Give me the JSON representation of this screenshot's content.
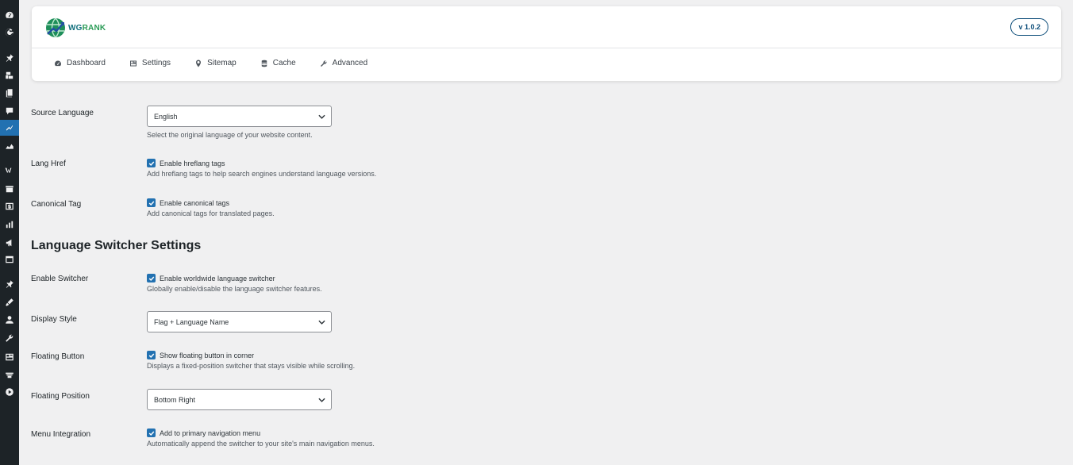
{
  "admin_menu": {
    "icons": [
      "dashboard-icon",
      "google-icon",
      "pin-icon",
      "media-icon",
      "pages-icon",
      "comments-icon",
      "wgrank-icon",
      "chart-icon",
      "woo-icon",
      "products-icon",
      "payments-icon",
      "analytics-icon",
      "marketing-icon",
      "calendar-icon",
      "tools-pin-icon",
      "appearance-icon",
      "users-icon",
      "wrench-icon",
      "settings-icon",
      "table-icon",
      "play-icon"
    ]
  },
  "header": {
    "logo_text_a": "WG",
    "logo_text_b": "RANK",
    "version": "v 1.0.2",
    "tabs": [
      {
        "label": "Dashboard",
        "icon": "dashboard-icon"
      },
      {
        "label": "Settings",
        "icon": "settings-icon"
      },
      {
        "label": "Sitemap",
        "icon": "map-pin-icon"
      },
      {
        "label": "Cache",
        "icon": "database-icon"
      },
      {
        "label": "Advanced",
        "icon": "wrench-icon"
      }
    ]
  },
  "settings": {
    "source_language": {
      "label": "Source Language",
      "value": "English",
      "description": "Select the original language of your website content."
    },
    "lang_href": {
      "label": "Lang Href",
      "checkbox_label": "Enable hreflang tags",
      "checked": true,
      "description": "Add hreflang tags to help search engines understand language versions."
    },
    "canonical_tag": {
      "label": "Canonical Tag",
      "checkbox_label": "Enable canonical tags",
      "checked": true,
      "description": "Add canonical tags for translated pages."
    }
  },
  "switcher": {
    "section_title": "Language Switcher Settings",
    "enable_switcher": {
      "label": "Enable Switcher",
      "checkbox_label": "Enable worldwide language switcher",
      "checked": true,
      "description": "Globally enable/disable the language switcher features."
    },
    "display_style": {
      "label": "Display Style",
      "value": "Flag + Language Name"
    },
    "floating_button": {
      "label": "Floating Button",
      "checkbox_label": "Show floating button in corner",
      "checked": true,
      "description": "Displays a fixed-position switcher that stays visible while scrolling."
    },
    "floating_position": {
      "label": "Floating Position",
      "value": "Bottom Right"
    },
    "menu_integration": {
      "label": "Menu Integration",
      "checkbox_label": "Add to primary navigation menu",
      "checked": true,
      "description": "Automatically append the switcher to your site's main navigation menus."
    }
  },
  "colors": {
    "accent": "#2271b1",
    "sidebar": "#1d2327",
    "background": "#f0f0f1"
  }
}
